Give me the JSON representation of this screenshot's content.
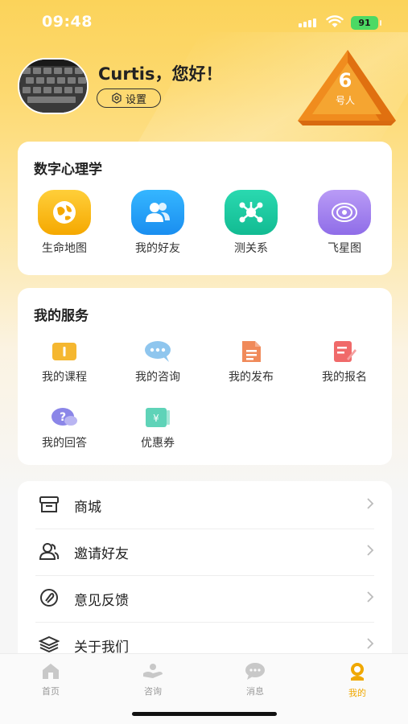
{
  "status_bar": {
    "time": "09:48",
    "battery": "91"
  },
  "profile": {
    "greeting": "Curtis，您好！",
    "settings_label": "设置",
    "rank_number": "6",
    "rank_label": "号人"
  },
  "digital_psychology": {
    "title": "数字心理学",
    "items": [
      {
        "label": "生命地图",
        "icon": "globe-icon",
        "color": "#f7b500"
      },
      {
        "label": "我的好友",
        "icon": "friends-icon",
        "color": "#1e9bf0"
      },
      {
        "label": "测关系",
        "icon": "network-icon",
        "color": "#16c9a0"
      },
      {
        "label": "飞星图",
        "icon": "galaxy-icon",
        "color": "#a07cf0"
      }
    ]
  },
  "my_services": {
    "title": "我的服务",
    "items": [
      {
        "label": "我的课程",
        "icon": "course-icon",
        "color": "#f5b730"
      },
      {
        "label": "我的咨询",
        "icon": "chat-icon",
        "color": "#8fc6ee"
      },
      {
        "label": "我的发布",
        "icon": "document-icon",
        "color": "#f08a5a"
      },
      {
        "label": "我的报名",
        "icon": "signup-icon",
        "color": "#f06a6a"
      },
      {
        "label": "我的回答",
        "icon": "question-icon",
        "color": "#8b86e8"
      },
      {
        "label": "优惠券",
        "icon": "coupon-icon",
        "color": "#5fd3b8"
      }
    ]
  },
  "menu": {
    "items": [
      {
        "label": "商城",
        "icon": "store-icon"
      },
      {
        "label": "邀请好友",
        "icon": "invite-icon"
      },
      {
        "label": "意见反馈",
        "icon": "feedback-icon"
      },
      {
        "label": "关于我们",
        "icon": "about-icon"
      }
    ]
  },
  "tabbar": {
    "items": [
      {
        "label": "首页",
        "icon": "home-icon",
        "active": false
      },
      {
        "label": "咨询",
        "icon": "consult-icon",
        "active": false
      },
      {
        "label": "消息",
        "icon": "message-icon",
        "active": false
      },
      {
        "label": "我的",
        "icon": "profile-icon",
        "active": true
      }
    ],
    "active_color": "#f0a800"
  }
}
